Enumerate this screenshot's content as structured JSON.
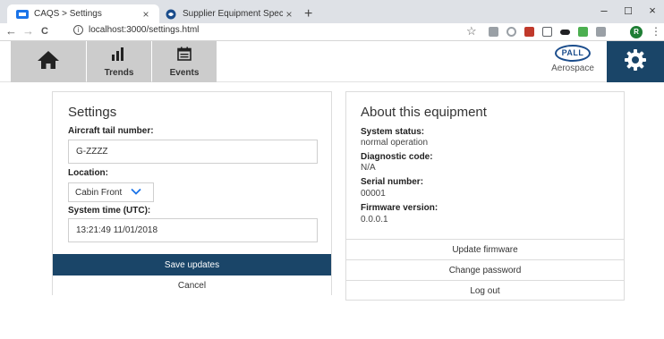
{
  "browser": {
    "tabs": [
      {
        "title": "CAQS > Settings",
        "close": "×"
      },
      {
        "title": "Supplier Equipment Specification",
        "close": "×"
      }
    ],
    "new_tab": "+",
    "window_controls": {
      "minimize": "–",
      "maximize": "☐",
      "close": "×"
    },
    "nav": {
      "back": "←",
      "forward": "→",
      "reload": "C"
    },
    "address": "localhost:3000/settings.html",
    "info_icon": "i",
    "profile_initial": "R",
    "menu": "⋮",
    "bookmark": "☆",
    "extension_colors": [
      "#9aa0a6",
      "#9aa0a6",
      "#c0392b",
      "#5f6368",
      "#202124",
      "#4caf50",
      "#9aa0a6"
    ]
  },
  "header": {
    "nav": [
      {
        "id": "home",
        "icon": "home-icon",
        "label": ""
      },
      {
        "id": "trends",
        "icon": "bar-chart-icon",
        "label": "Trends"
      },
      {
        "id": "events",
        "icon": "calendar-icon",
        "label": "Events"
      }
    ],
    "brand": {
      "logo_text": "PALL",
      "subtitle": "Aerospace",
      "color": "#1b4d8c"
    },
    "settings_icon": "gear-icon",
    "accent_color": "#1a4568"
  },
  "settings": {
    "title": "Settings",
    "tail_label": "Aircraft tail number:",
    "tail_value": "G-ZZZZ",
    "location_label": "Location:",
    "location_value": "Cabin Front",
    "time_label": "System time (UTC):",
    "time_value": "13:21:49 11/01/2018",
    "save_label": "Save updates",
    "cancel_label": "Cancel"
  },
  "about": {
    "title": "About this equipment",
    "status_label": "System status:",
    "status_value": "normal operation",
    "diag_label": "Diagnostic code:",
    "diag_value": "N/A",
    "serial_label": "Serial number:",
    "serial_value": "00001",
    "firmware_label": "Firmware version:",
    "firmware_value": "0.0.0.1",
    "actions": [
      "Update firmware",
      "Change password",
      "Log out"
    ]
  }
}
